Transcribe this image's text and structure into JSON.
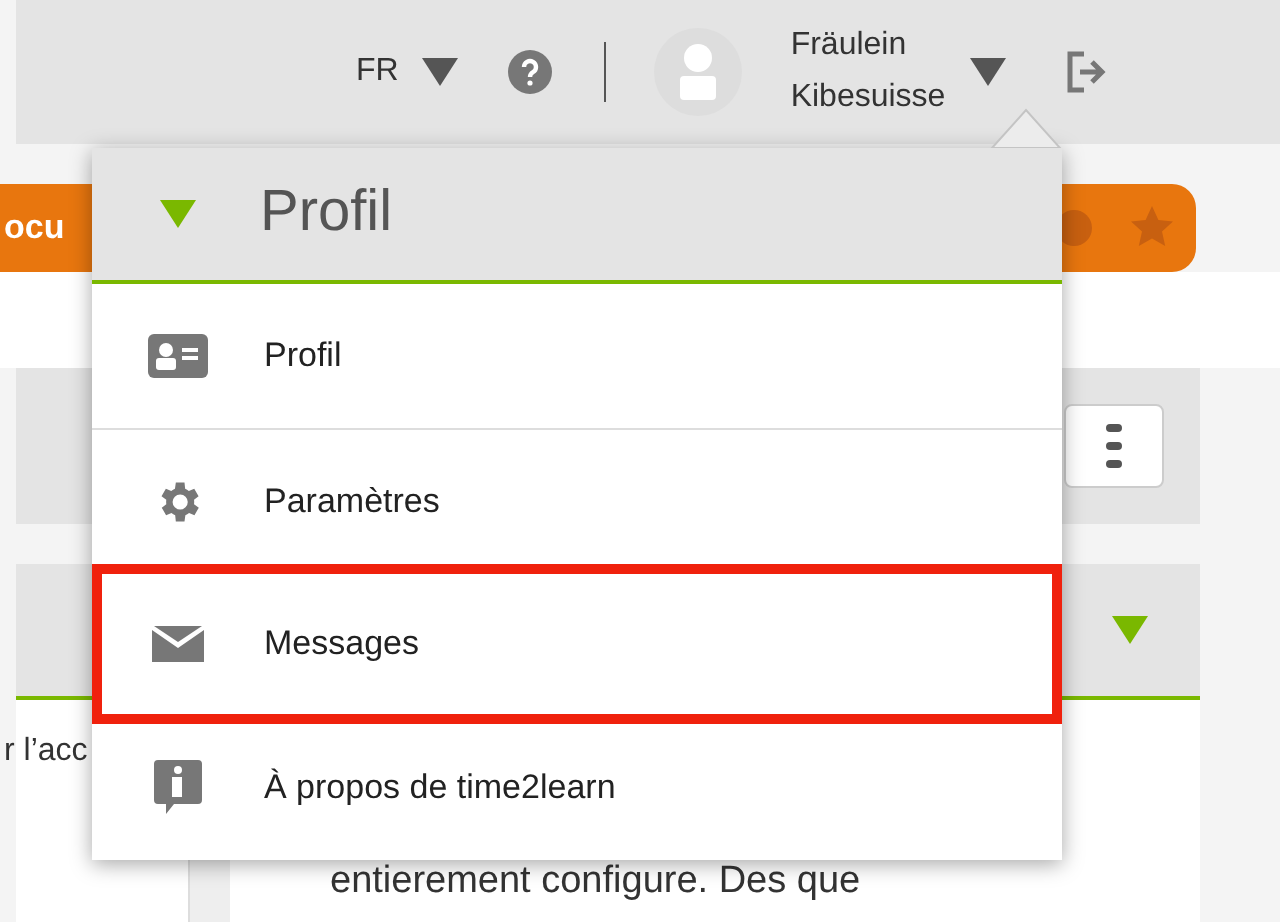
{
  "header": {
    "language": "FR",
    "user_name_lines": [
      "Fräulein",
      "Kibesuisse"
    ]
  },
  "background": {
    "tab_text": "ocu",
    "left_text": "r l’acc",
    "body_text": "entierement configure. Des que"
  },
  "menu": {
    "title": "Profil",
    "items": [
      {
        "kind": "card",
        "label": "Profil",
        "highlighted": false
      },
      {
        "kind": "gear",
        "label": "Paramètres",
        "highlighted": false
      },
      {
        "kind": "mail",
        "label": "Messages",
        "highlighted": true
      },
      {
        "kind": "info",
        "label": "À propos de time2learn",
        "highlighted": false
      }
    ]
  }
}
